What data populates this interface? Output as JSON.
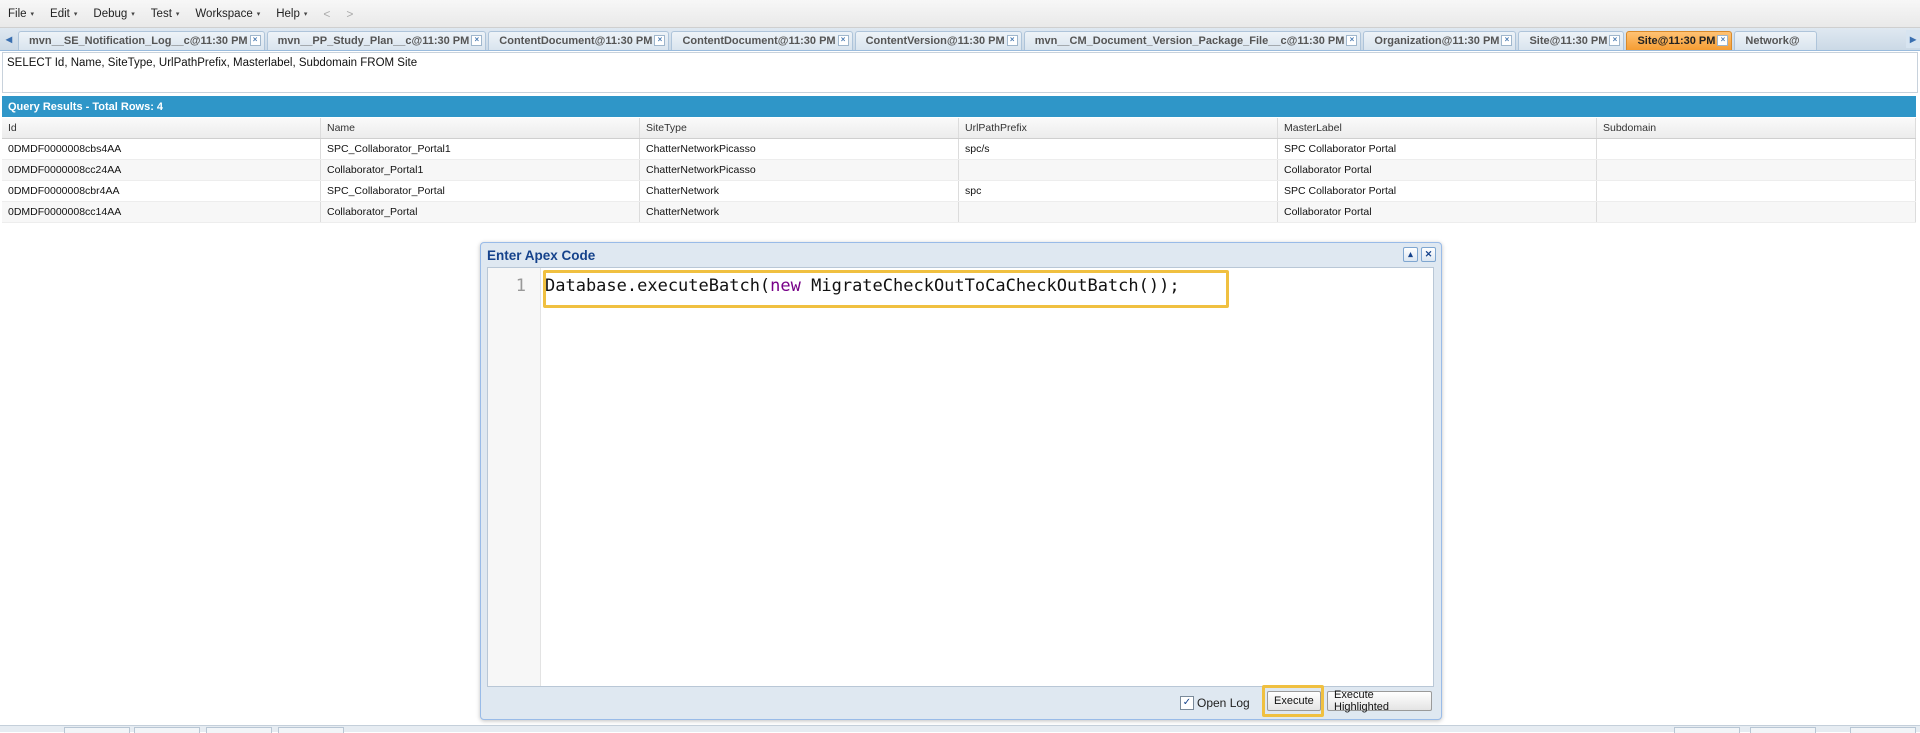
{
  "menu": {
    "items": [
      {
        "label": "File",
        "caret": "▾"
      },
      {
        "label": "Edit",
        "caret": "▾"
      },
      {
        "label": "Debug",
        "caret": "▾"
      },
      {
        "label": "Test",
        "caret": "▾"
      },
      {
        "label": "Workspace",
        "caret": "▾"
      },
      {
        "label": "Help",
        "caret": "▾"
      }
    ],
    "back": "<",
    "forward": ">"
  },
  "tabs": {
    "scroll_left": "◂",
    "scroll_right": "▸",
    "close": "×",
    "items": [
      {
        "label": "mvn__SE_Notification_Log__c@11:30 PM",
        "active": false
      },
      {
        "label": "mvn__PP_Study_Plan__c@11:30 PM",
        "active": false
      },
      {
        "label": "ContentDocument@11:30 PM",
        "active": false
      },
      {
        "label": "ContentDocument@11:30 PM",
        "active": false
      },
      {
        "label": "ContentVersion@11:30 PM",
        "active": false
      },
      {
        "label": "mvn__CM_Document_Version_Package_File__c@11:30 PM",
        "active": false
      },
      {
        "label": "Organization@11:30 PM",
        "active": false
      },
      {
        "label": "Site@11:30 PM",
        "active": false
      },
      {
        "label": "Site@11:30 PM",
        "active": true
      },
      {
        "label": "Network@",
        "active": false
      }
    ]
  },
  "query": {
    "text": "SELECT Id, Name, SiteType, UrlPathPrefix, Masterlabel, Subdomain FROM Site"
  },
  "results": {
    "title": "Query Results - Total Rows: 4",
    "columns": [
      "Id",
      "Name",
      "SiteType",
      "UrlPathPrefix",
      "MasterLabel",
      "Subdomain"
    ],
    "rows": [
      [
        "0DMDF0000008cbs4AA",
        "SPC_Collaborator_Portal1",
        "ChatterNetworkPicasso",
        "spc/s",
        "SPC Collaborator Portal",
        ""
      ],
      [
        "0DMDF0000008cc24AA",
        "Collaborator_Portal1",
        "ChatterNetworkPicasso",
        "",
        "Collaborator Portal",
        ""
      ],
      [
        "0DMDF0000008cbr4AA",
        "SPC_Collaborator_Portal",
        "ChatterNetwork",
        "spc",
        "SPC Collaborator Portal",
        ""
      ],
      [
        "0DMDF0000008cc14AA",
        "Collaborator_Portal",
        "ChatterNetwork",
        "",
        "Collaborator Portal",
        ""
      ]
    ]
  },
  "apex_dialog": {
    "title": "Enter Apex Code",
    "line_number": "1",
    "code": {
      "before": "Database.executeBatch(",
      "keyword": "new",
      "after": " MigrateCheckOutToCaCheckOutBatch());"
    },
    "collapse_icon": "▴",
    "close_icon": "✕",
    "open_log": {
      "label": "Open Log",
      "checked": true,
      "check_mark": "✓"
    },
    "execute_label": "Execute",
    "execute_highlighted_label": "Execute Highlighted"
  }
}
